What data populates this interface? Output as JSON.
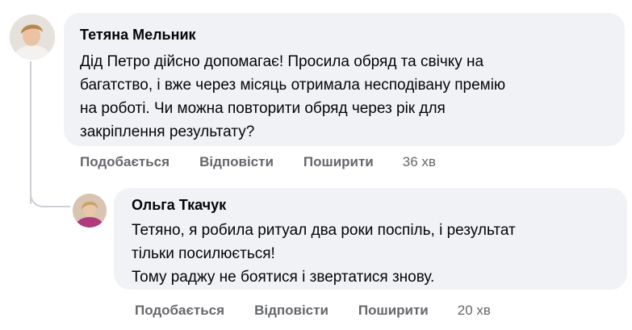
{
  "comments": [
    {
      "author": "Тетяна Мельник",
      "text": "Дід Петро дійсно допомагає! Просила обряд та свічку на\nбагатство, і вже через місяць отримала несподівану премію\nна роботі. Чи можна повторити обряд через рік для\nзакріплення результату?",
      "like_label": "Подобається",
      "reply_label": "Відповісти",
      "share_label": "Поширити",
      "time": "36 хв"
    },
    {
      "author": "Ольга Ткачук",
      "text": "Тетяно, я робила ритуал два роки поспіль, і результат\nтільки посилюється!\nТому раджу не боятися і звертатися знову.",
      "like_label": "Подобається",
      "reply_label": "Відповісти",
      "share_label": "Поширити",
      "time": "20 хв"
    }
  ]
}
